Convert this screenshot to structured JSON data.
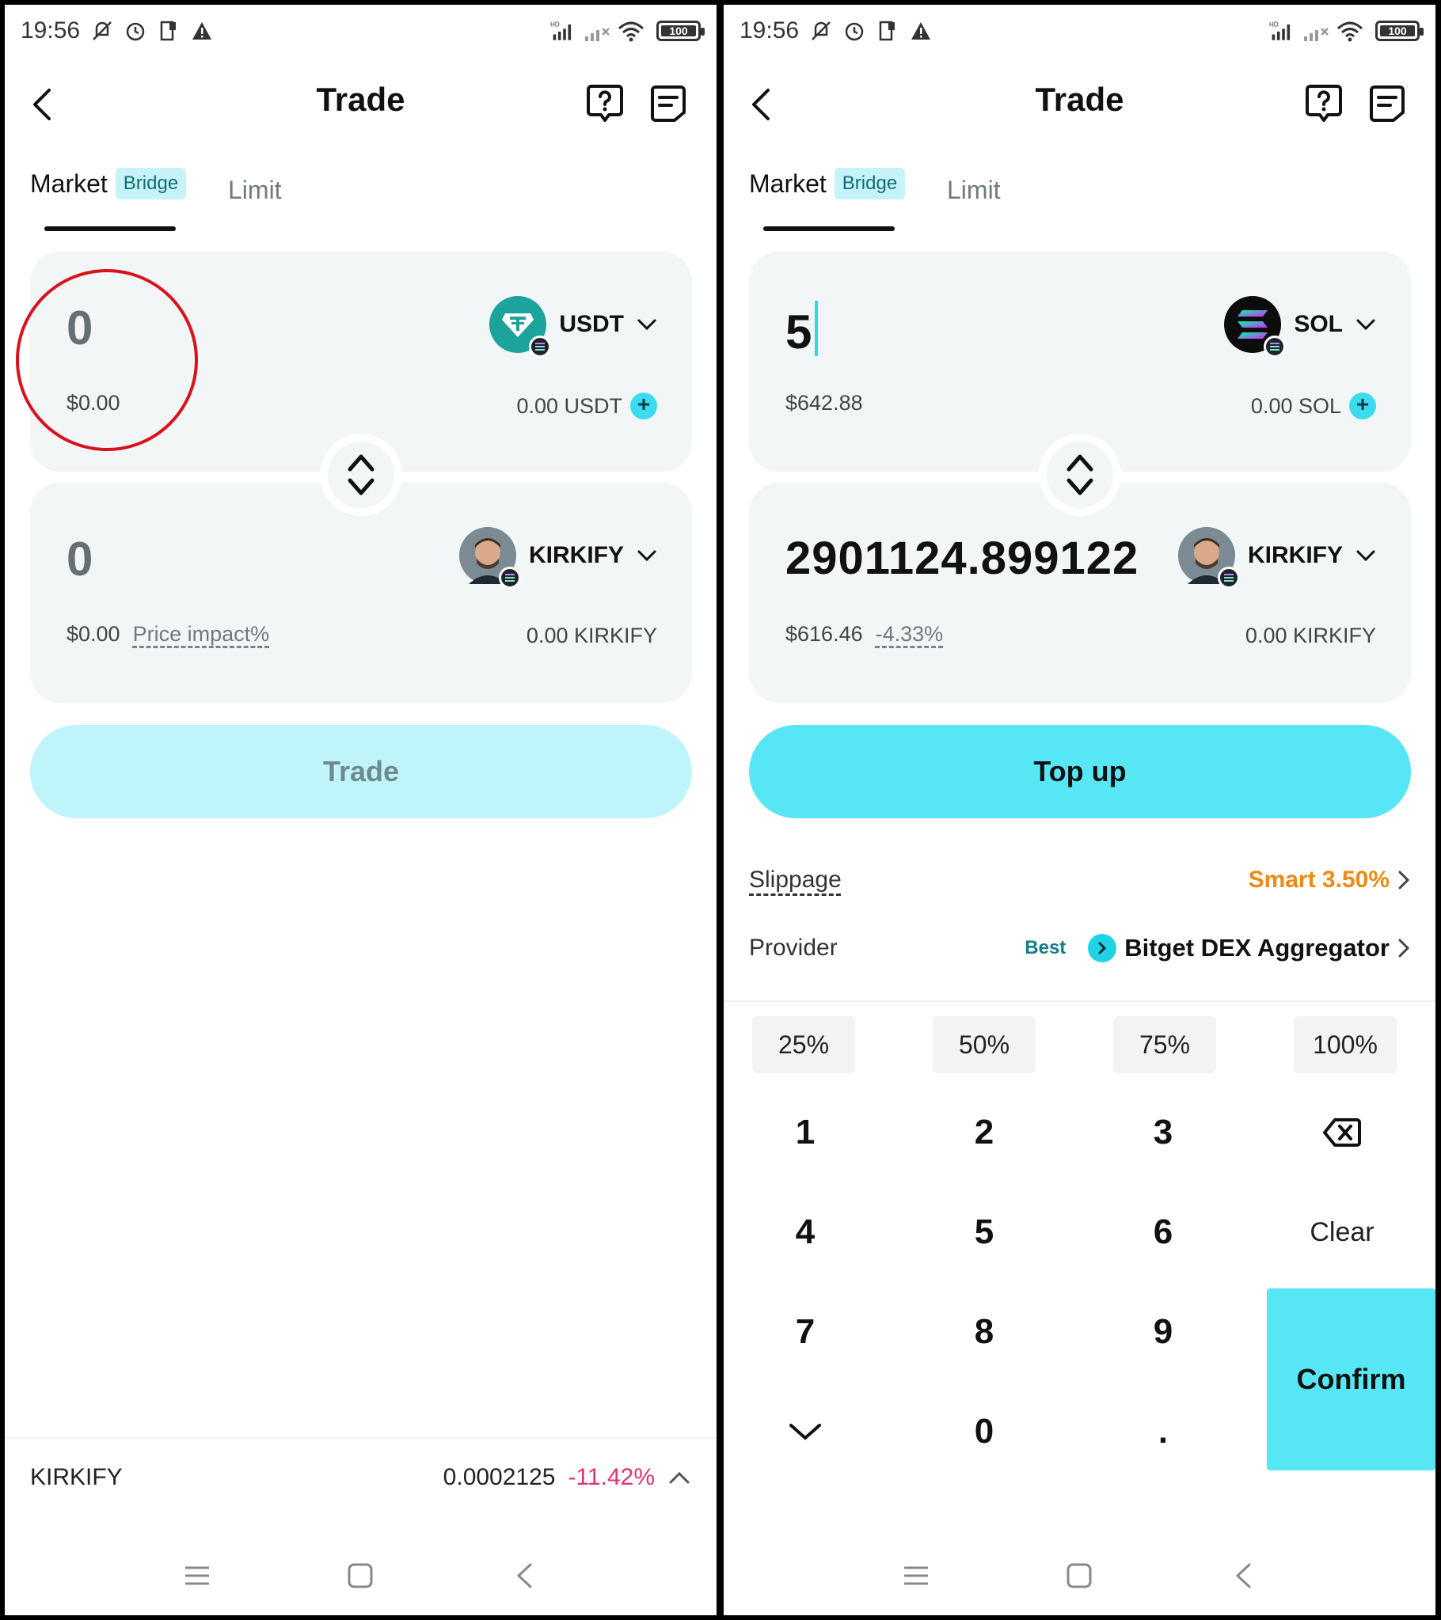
{
  "status": {
    "time": "19:56",
    "battery": "100",
    "network_label": "HD"
  },
  "header": {
    "title": "Trade"
  },
  "tabs": {
    "market": "Market",
    "bridge_badge": "Bridge",
    "limit": "Limit"
  },
  "left": {
    "from": {
      "amount": "0",
      "usd": "$0.00",
      "token": "USDT",
      "balance": "0.00 USDT"
    },
    "to": {
      "amount": "0",
      "usd": "$0.00",
      "price_impact": "Price impact%",
      "token": "KIRKIFY",
      "balance": "0.00 KIRKIFY"
    },
    "action_button": "Trade",
    "ticker": {
      "symbol": "KIRKIFY",
      "price": "0.0002125",
      "change": "-11.42%"
    }
  },
  "right": {
    "from": {
      "amount": "5",
      "usd": "$642.88",
      "token": "SOL",
      "balance": "0.00 SOL"
    },
    "to": {
      "amount": "2901124.899122",
      "usd": "$616.46",
      "price_impact": "-4.33%",
      "token": "KIRKIFY",
      "balance": "0.00 KIRKIFY"
    },
    "action_button": "Top up",
    "slippage": {
      "label": "Slippage",
      "value": "Smart 3.50%"
    },
    "provider": {
      "label": "Provider",
      "badge": "Best",
      "name": "Bitget DEX Aggregator"
    },
    "percent_buttons": [
      "25%",
      "50%",
      "75%",
      "100%"
    ],
    "keys": {
      "k1": "1",
      "k2": "2",
      "k3": "3",
      "k4": "4",
      "k5": "5",
      "k6": "6",
      "k7": "7",
      "k8": "8",
      "k9": "9",
      "k0": "0",
      "dot": ".",
      "clear": "Clear",
      "confirm": "Confirm"
    }
  },
  "colors": {
    "accent": "#56e6f4",
    "accent_disabled": "#bff5fa",
    "negative": "#e0336b",
    "slippage": "#ec8a12",
    "annotation": "#d8121c"
  },
  "icons": {
    "back": "chevron-left-icon",
    "help": "help-chat-icon",
    "orders": "orders-list-icon",
    "swap": "swap-vertical-icon",
    "backspace": "backspace-icon",
    "collapse": "chevron-down-icon"
  }
}
